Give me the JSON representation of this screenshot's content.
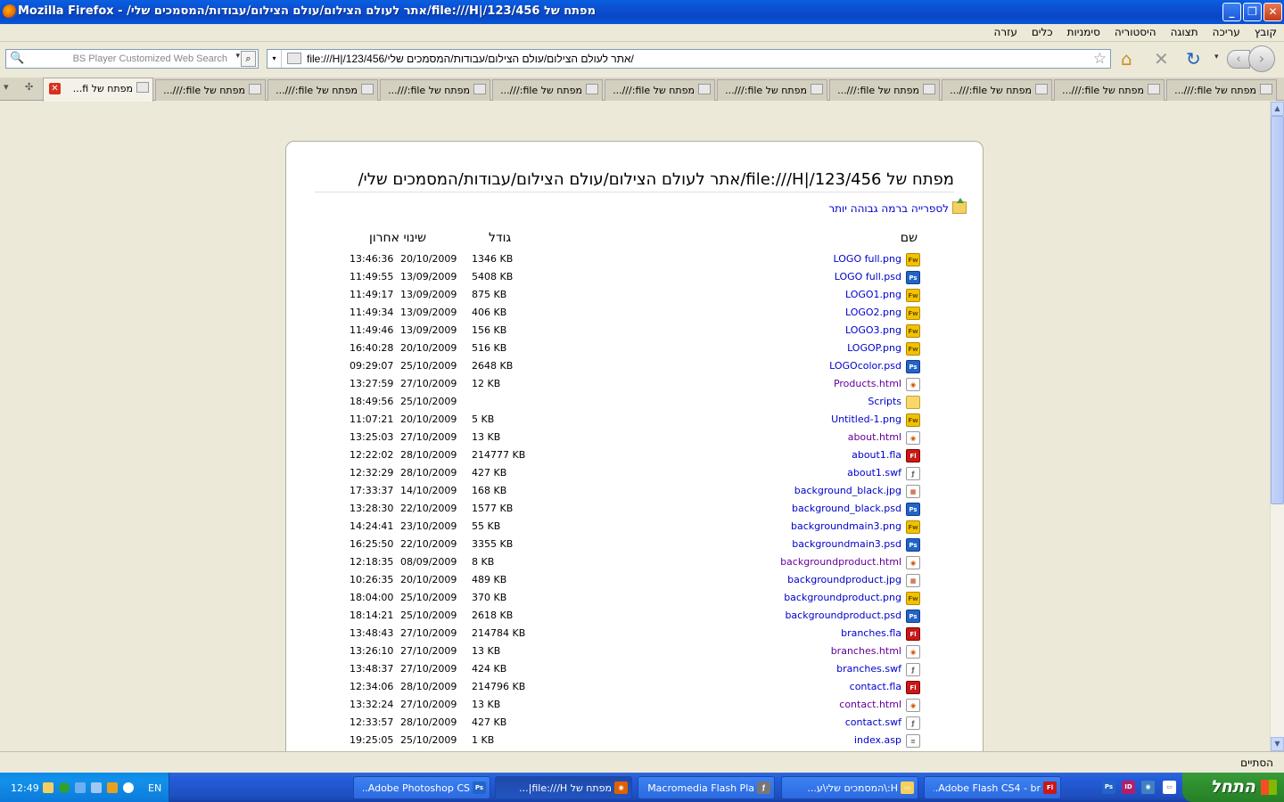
{
  "window": {
    "title": "מפתח של file:///H|/123/456/אתר לעולם הצילום/עולם הצילום/עבודות/המסמכים שלי/ - Mozilla Firefox",
    "min": "_",
    "max": "❐",
    "close": "✕"
  },
  "menu": [
    "קובץ",
    "עריכה",
    "תצוגה",
    "היסטוריה",
    "סימניות",
    "כלים",
    "עזרה"
  ],
  "search": {
    "placeholder": "BS Player Customized Web Search"
  },
  "url": "file:///H|/123/456/אתר לעולם הצילום/עולם הצילום/עבודות/המסמכים שלי/",
  "tabs": {
    "active": "מפתח של fi...",
    "others": [
      "מפתח של file:///...",
      "מפתח של file:///...",
      "מפתח של file:///...",
      "מפתח של file:///...",
      "מפתח של file:///...",
      "מפתח של file:///...",
      "מפתח של file:///...",
      "מפתח של file:///...",
      "מפתח של file:///...",
      "מפתח של file:///..."
    ]
  },
  "listing": {
    "heading": "מפתח של file:///H|/123/456/אתר לעולם הצילום/עולם הצילום/עבודות/המסמכים שלי/",
    "parent_link": "לספרייה ברמה גבוהה יותר",
    "columns": {
      "name": "שם",
      "size": "גודל",
      "modified": "שינוי אחרון"
    },
    "files": [
      {
        "name": "LOGO full.png",
        "type": "png",
        "icon": "Fw",
        "size": "1346 KB",
        "date": "20/10/2009",
        "time": "13:46:36",
        "visited": false
      },
      {
        "name": "LOGO full.psd",
        "type": "psd",
        "icon": "Ps",
        "size": "5408 KB",
        "date": "13/09/2009",
        "time": "11:49:55",
        "visited": false
      },
      {
        "name": "LOGO1.png",
        "type": "png",
        "icon": "Fw",
        "size": "875 KB",
        "date": "13/09/2009",
        "time": "11:49:17",
        "visited": false
      },
      {
        "name": "LOGO2.png",
        "type": "png",
        "icon": "Fw",
        "size": "406 KB",
        "date": "13/09/2009",
        "time": "11:49:34",
        "visited": false
      },
      {
        "name": "LOGO3.png",
        "type": "png",
        "icon": "Fw",
        "size": "156 KB",
        "date": "13/09/2009",
        "time": "11:49:46",
        "visited": false
      },
      {
        "name": "LOGOP.png",
        "type": "png",
        "icon": "Fw",
        "size": "516 KB",
        "date": "20/10/2009",
        "time": "16:40:28",
        "visited": false
      },
      {
        "name": "LOGOcolor.psd",
        "type": "psd",
        "icon": "Ps",
        "size": "2648 KB",
        "date": "25/10/2009",
        "time": "09:29:07",
        "visited": false
      },
      {
        "name": "Products.html",
        "type": "html",
        "icon": "◉",
        "size": "12 KB",
        "date": "27/10/2009",
        "time": "13:27:59",
        "visited": true
      },
      {
        "name": "Scripts",
        "type": "folder",
        "icon": "",
        "size": "",
        "date": "25/10/2009",
        "time": "18:49:56",
        "visited": false
      },
      {
        "name": "Untitled-1.png",
        "type": "png",
        "icon": "Fw",
        "size": "5 KB",
        "date": "20/10/2009",
        "time": "11:07:21",
        "visited": false
      },
      {
        "name": "about.html",
        "type": "html",
        "icon": "◉",
        "size": "13 KB",
        "date": "27/10/2009",
        "time": "13:25:03",
        "visited": true
      },
      {
        "name": "about1.fla",
        "type": "fla",
        "icon": "Fl",
        "size": "214777 KB",
        "date": "28/10/2009",
        "time": "12:22:02",
        "visited": false
      },
      {
        "name": "about1.swf",
        "type": "swf",
        "icon": "ƒ",
        "size": "427 KB",
        "date": "28/10/2009",
        "time": "12:32:29",
        "visited": false
      },
      {
        "name": "background_black.jpg",
        "type": "jpg",
        "icon": "▦",
        "size": "168 KB",
        "date": "14/10/2009",
        "time": "17:33:37",
        "visited": false
      },
      {
        "name": "background_black.psd",
        "type": "psd",
        "icon": "Ps",
        "size": "1577 KB",
        "date": "22/10/2009",
        "time": "13:28:30",
        "visited": false
      },
      {
        "name": "backgroundmain3.png",
        "type": "png",
        "icon": "Fw",
        "size": "55 KB",
        "date": "23/10/2009",
        "time": "14:24:41",
        "visited": false
      },
      {
        "name": "backgroundmain3.psd",
        "type": "psd",
        "icon": "Ps",
        "size": "3355 KB",
        "date": "22/10/2009",
        "time": "16:25:50",
        "visited": false
      },
      {
        "name": "backgroundproduct.html",
        "type": "html",
        "icon": "◉",
        "size": "8 KB",
        "date": "08/09/2009",
        "time": "12:18:35",
        "visited": true
      },
      {
        "name": "backgroundproduct.jpg",
        "type": "jpg",
        "icon": "▦",
        "size": "489 KB",
        "date": "20/10/2009",
        "time": "10:26:35",
        "visited": false
      },
      {
        "name": "backgroundproduct.png",
        "type": "png",
        "icon": "Fw",
        "size": "370 KB",
        "date": "25/10/2009",
        "time": "18:04:00",
        "visited": false
      },
      {
        "name": "backgroundproduct.psd",
        "type": "psd",
        "icon": "Ps",
        "size": "2618 KB",
        "date": "25/10/2009",
        "time": "18:14:21",
        "visited": false
      },
      {
        "name": "branches.fla",
        "type": "fla",
        "icon": "Fl",
        "size": "214784 KB",
        "date": "27/10/2009",
        "time": "13:48:43",
        "visited": false
      },
      {
        "name": "branches.html",
        "type": "html",
        "icon": "◉",
        "size": "13 KB",
        "date": "27/10/2009",
        "time": "13:26:10",
        "visited": true
      },
      {
        "name": "branches.swf",
        "type": "swf",
        "icon": "ƒ",
        "size": "424 KB",
        "date": "27/10/2009",
        "time": "13:48:37",
        "visited": false
      },
      {
        "name": "contact.fla",
        "type": "fla",
        "icon": "Fl",
        "size": "214796 KB",
        "date": "28/10/2009",
        "time": "12:34:06",
        "visited": false
      },
      {
        "name": "contact.html",
        "type": "html",
        "icon": "◉",
        "size": "13 KB",
        "date": "27/10/2009",
        "time": "13:32:24",
        "visited": true
      },
      {
        "name": "contact.swf",
        "type": "swf",
        "icon": "ƒ",
        "size": "427 KB",
        "date": "28/10/2009",
        "time": "12:33:57",
        "visited": false
      },
      {
        "name": "index.asp",
        "type": "asp",
        "icon": "≡",
        "size": "1 KB",
        "date": "25/10/2009",
        "time": "19:25:05",
        "visited": false
      }
    ]
  },
  "status": "הסתיים",
  "taskbar": {
    "start": "התחל",
    "clock": "12:49",
    "lang": "EN",
    "buttons": [
      {
        "label": "Adobe Flash CS4 - br...",
        "icon": "Fl",
        "color": "#C81818"
      },
      {
        "label": "H:\\המסמכים שלי\\ע...",
        "icon": "▭",
        "color": "#F4D060"
      },
      {
        "label": "Macromedia Flash Pla...",
        "icon": "ƒ",
        "color": "#777777"
      },
      {
        "label": "מפתח של file:///H|...",
        "icon": "◉",
        "color": "#E06000"
      },
      {
        "label": "Adobe Photoshop CS...",
        "icon": "Ps",
        "color": "#2264C8"
      }
    ]
  }
}
